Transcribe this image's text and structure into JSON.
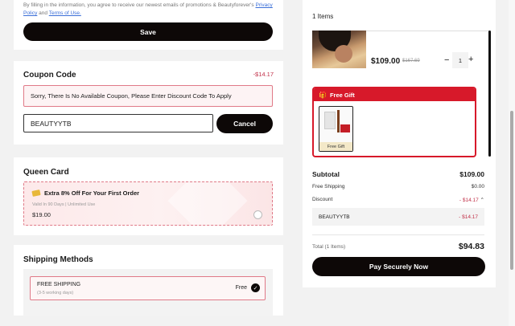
{
  "legal": {
    "text_prefix": "By filling in the information, you agree to receive our newest emails of promotions & Beautyforever's",
    "privacy_link": "Privacy Policy",
    "and": "and",
    "terms_link": "Terms of Use."
  },
  "save": {
    "label": "Save"
  },
  "coupon": {
    "title": "Coupon Code",
    "amount": "-$14.17",
    "message": "Sorry, There Is No Available Coupon, Please Enter Discount Code To Apply",
    "input_value": "BEAUTYYTB",
    "cancel_label": "Cancel"
  },
  "queen": {
    "title": "Queen Card",
    "headline": "Extra 8% Off For Your First Order",
    "validity": "Valid In 90 Days | Unlimited Use",
    "price": "$19.00",
    "selected": false
  },
  "shipping": {
    "title": "Shipping Methods",
    "method": "FREE SHIPPING",
    "days": "(3-5 working days)",
    "price": "Free",
    "selected": true
  },
  "summary": {
    "items_count": "1 Items",
    "product": {
      "price": "$109.00",
      "old_price": "$167.69",
      "qty": "1",
      "minus": "−",
      "plus": "+"
    },
    "gift": {
      "title": "Free Gift",
      "item_label": "Free Gift"
    },
    "subtotal_label": "Subtotal",
    "subtotal_value": "$109.00",
    "shipping_label": "Free Shipping",
    "shipping_value": "$0.00",
    "discount_label": "Discount",
    "discount_value": "- $14.17",
    "code_name": "BEAUTYYTB",
    "code_value": "- $14.17",
    "total_label": "Total (1 Items)",
    "total_value": "$94.83",
    "pay_label": "Pay Securely Now"
  },
  "colors": {
    "accent_red": "#d7192a",
    "discount_red": "#c2324a",
    "button_black": "#0d0807"
  }
}
